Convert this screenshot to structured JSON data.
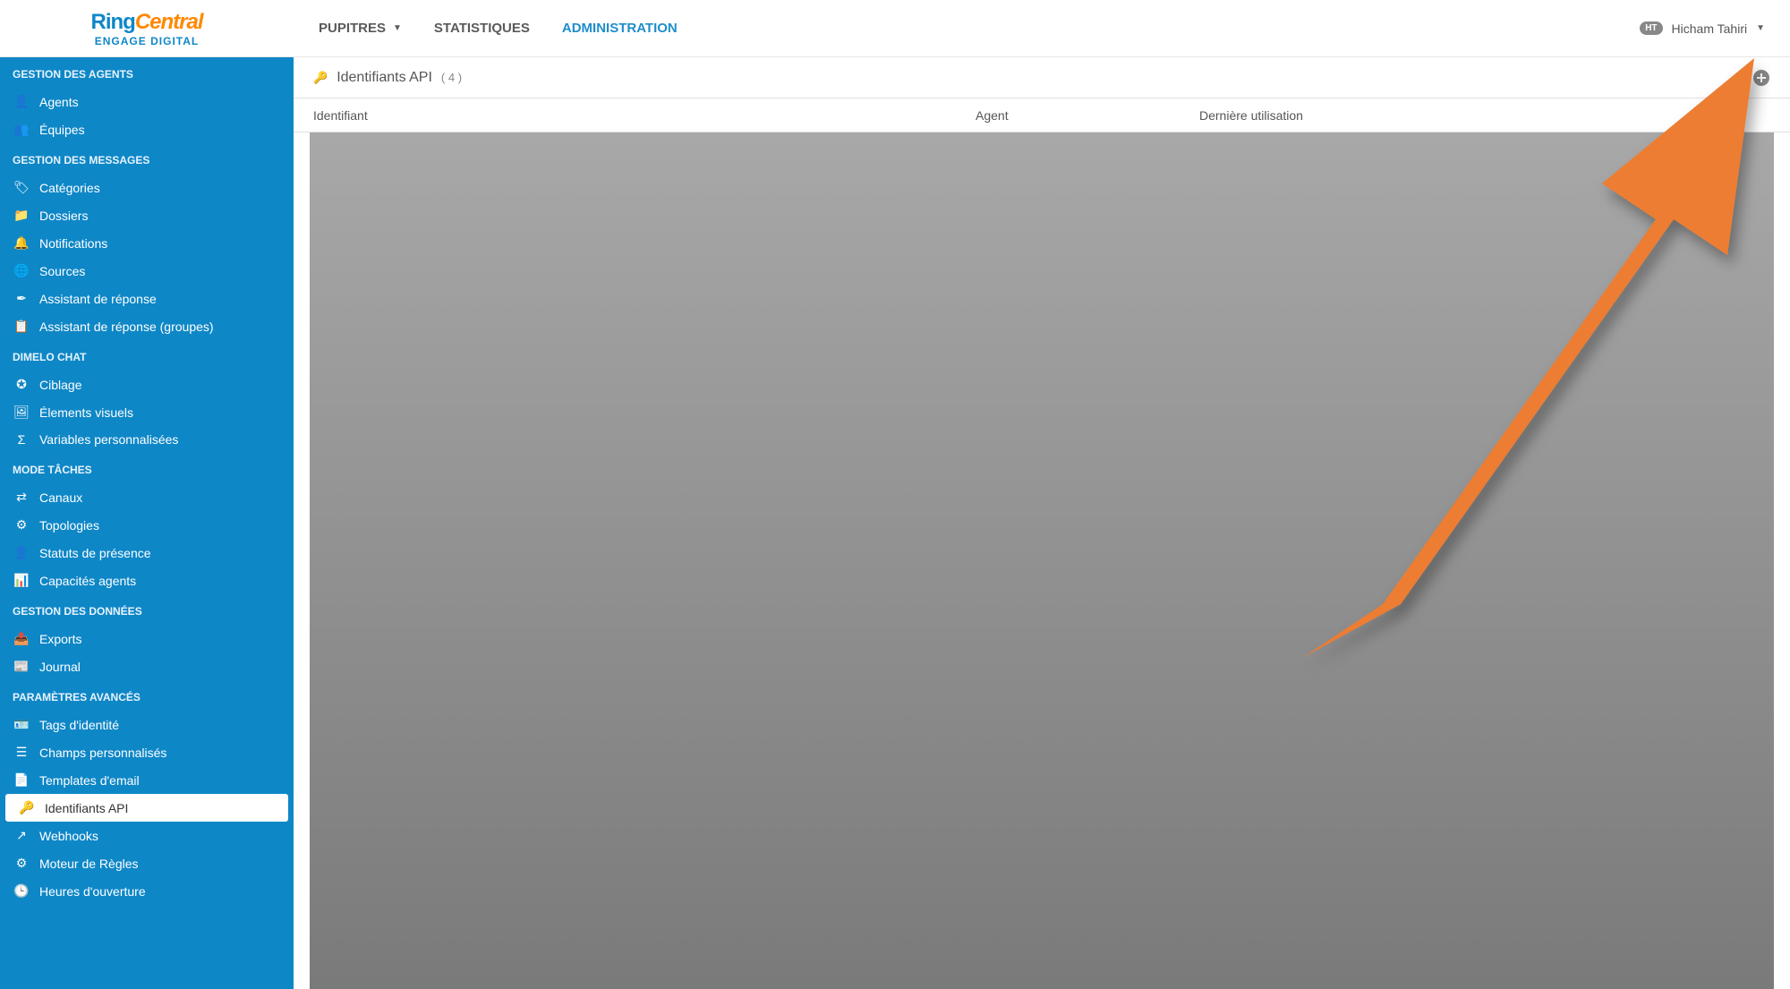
{
  "logo": {
    "ring": "Ring",
    "central": "Central",
    "sub": "ENGAGE DIGITAL"
  },
  "topnav": {
    "pupitres": "PUPITRES",
    "statistiques": "STATISTIQUES",
    "administration": "ADMINISTRATION"
  },
  "user": {
    "initials": "HT",
    "name": "Hicham Tahiri"
  },
  "sidebar": {
    "agents_section": "GESTION DES AGENTS",
    "agents": "Agents",
    "equipes": "Équipes",
    "messages_section": "GESTION DES MESSAGES",
    "categories": "Catégories",
    "dossiers": "Dossiers",
    "notifications": "Notifications",
    "sources": "Sources",
    "assistant": "Assistant de réponse",
    "assistant_groupes": "Assistant de réponse (groupes)",
    "chat_section": "DIMELO CHAT",
    "ciblage": "Ciblage",
    "elements_visuels": "Élements visuels",
    "variables": "Variables personnalisées",
    "taches_section": "MODE TÂCHES",
    "canaux": "Canaux",
    "topologies": "Topologies",
    "statuts": "Statuts de présence",
    "capacites": "Capacités agents",
    "donnees_section": "GESTION DES DONNÉES",
    "exports": "Exports",
    "journal": "Journal",
    "avances_section": "PARAMÈTRES AVANCÉS",
    "tags": "Tags d'identité",
    "champs": "Champs personnalisés",
    "templates": "Templates d'email",
    "identifiants": "Identifiants API",
    "webhooks": "Webhooks",
    "moteur": "Moteur de Règles",
    "heures": "Heures d'ouverture"
  },
  "page": {
    "title": "Identifiants API",
    "count": "( 4 )",
    "columns": {
      "id": "Identifiant",
      "agent": "Agent",
      "last": "Dernière utilisation"
    }
  }
}
